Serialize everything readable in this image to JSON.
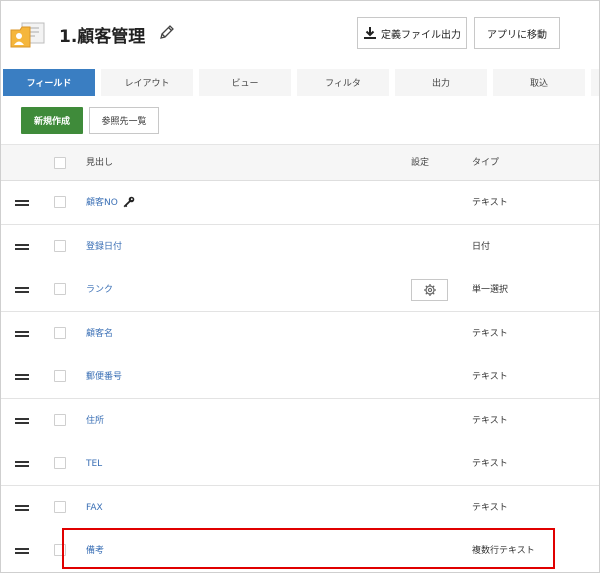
{
  "header": {
    "title": "1.顧客管理",
    "export_label": "定義ファイル出力",
    "move_label": "アプリに移動"
  },
  "tabs": [
    {
      "label": "フィールド",
      "active": true
    },
    {
      "label": "レイアウト",
      "active": false
    },
    {
      "label": "ビュー",
      "active": false
    },
    {
      "label": "フィルタ",
      "active": false
    },
    {
      "label": "出力",
      "active": false
    },
    {
      "label": "取込",
      "active": false
    }
  ],
  "actions": {
    "new_label": "新規作成",
    "ref_label": "参照先一覧"
  },
  "table": {
    "headers": {
      "name": "見出し",
      "settings": "設定",
      "type": "タイプ"
    },
    "rows": [
      {
        "label": "顧客NO",
        "type": "テキスト",
        "key": true,
        "gear": false
      },
      {
        "label": "登録日付",
        "type": "日付",
        "key": false,
        "gear": false
      },
      {
        "label": "ランク",
        "type": "単一選択",
        "key": false,
        "gear": true
      },
      {
        "label": "顧客名",
        "type": "テキスト",
        "key": false,
        "gear": false
      },
      {
        "label": "郵便番号",
        "type": "テキスト",
        "key": false,
        "gear": false
      },
      {
        "label": "住所",
        "type": "テキスト",
        "key": false,
        "gear": false
      },
      {
        "label": "TEL",
        "type": "テキスト",
        "key": false,
        "gear": false
      },
      {
        "label": "FAX",
        "type": "テキスト",
        "key": false,
        "gear": false
      },
      {
        "label": "備考",
        "type": "複数行テキスト",
        "key": false,
        "gear": false
      }
    ]
  },
  "colors": {
    "accent_tab": "#3a7ec2",
    "primary_button": "#3f8b3a",
    "link": "#3a6fb5",
    "highlight": "#e00000"
  }
}
